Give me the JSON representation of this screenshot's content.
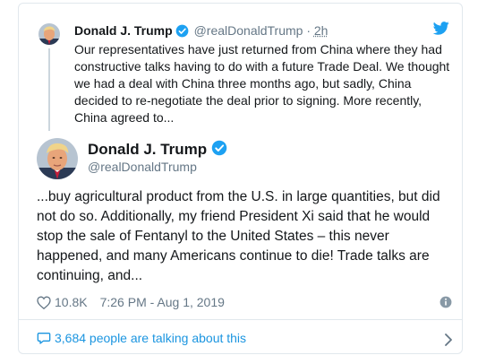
{
  "parent_tweet": {
    "author_name": "Donald J. Trump",
    "handle": "@realDonaldTrump",
    "separator": "·",
    "time_ago": "2h",
    "text": "Our representatives have just returned from China where they had constructive talks having to do with a future Trade Deal. We thought we had a deal with China three months ago, but sadly, China decided to re-negotiate the deal prior to signing. More recently, China agreed to..."
  },
  "main_tweet": {
    "author_name": "Donald J. Trump",
    "handle": "@realDonaldTrump",
    "text": "...buy agricultural product from the U.S. in large quantities, but did not do so. Additionally, my friend President Xi said that he would stop the sale of Fentanyl to the United States – this never happened, and many Americans continue to die! Trade talks are continuing, and...",
    "likes": "10.8K",
    "timestamp": "7:26 PM - Aug 1, 2019"
  },
  "footer": {
    "talking_text": "3,684 people are talking about this"
  },
  "colors": {
    "twitter_blue": "#1da1f2",
    "link_blue": "#1b95e0",
    "secondary_text": "#657786",
    "border": "#e1e8ed"
  },
  "icons": [
    "avatar",
    "verified-badge-icon",
    "twitter-bird-icon",
    "heart-icon",
    "info-icon",
    "speech-bubble-icon",
    "chevron-right-icon"
  ]
}
